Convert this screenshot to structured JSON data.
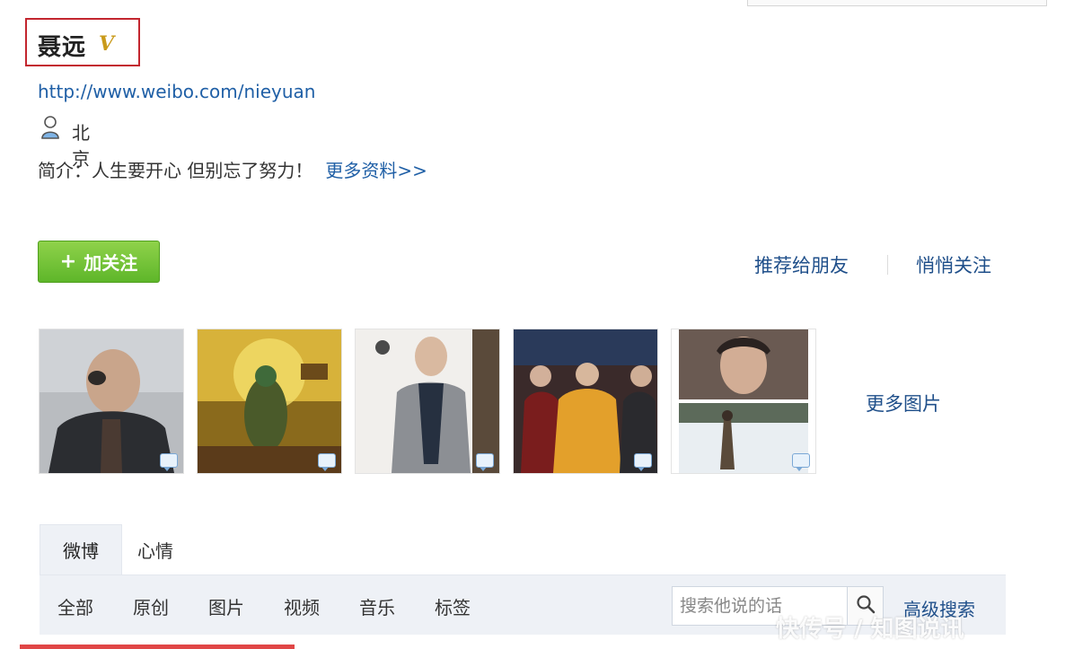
{
  "profile": {
    "name": "聂远",
    "verified_mark": "V",
    "url": "http://www.weibo.com/nieyuan",
    "location": "北京",
    "intro_label": "简介：",
    "intro_text": "人生要开心 但别忘了努力！",
    "more_info_link": "更多资料>>"
  },
  "actions": {
    "follow_button": "加关注",
    "follow_icon": "+",
    "recommend_link": "推荐给朋友",
    "quiet_follow_link": "悄悄关注"
  },
  "photos": {
    "more_link": "更多图片",
    "items": [
      {
        "icon": "comment-icon"
      },
      {
        "icon": "comment-icon"
      },
      {
        "icon": "comment-icon"
      },
      {
        "icon": "comment-icon"
      },
      {
        "icon": "comment-icon"
      }
    ]
  },
  "tabs": [
    "微博",
    "心情"
  ],
  "filters": [
    "全部",
    "原创",
    "图片",
    "视频",
    "音乐",
    "标签"
  ],
  "search": {
    "placeholder": "搜索他说的话",
    "advanced_link": "高级搜索"
  },
  "watermark": "快传号 / 知图说讯",
  "colors": {
    "accent_red": "#c3262f",
    "link_blue": "#1f4f8a",
    "follow_green": "#5eb62a",
    "tab_bg": "#eef1f6"
  }
}
